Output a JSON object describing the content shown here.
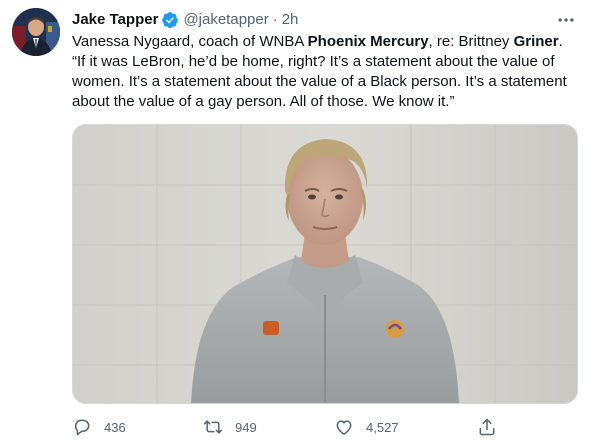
{
  "tweet": {
    "author_name": "Jake Tapper",
    "handle": "@jaketapper",
    "separator": "·",
    "time": "2h",
    "text_segments": [
      {
        "text": "Vanessa Nygaard, coach of WNBA ",
        "bold": false
      },
      {
        "text": "Phoenix Mercury",
        "bold": true
      },
      {
        "text": ", re: Brittney ",
        "bold": false
      },
      {
        "text": "Griner",
        "bold": true
      },
      {
        "text": ".",
        "bold": false
      }
    ],
    "quote": "“If it was LeBron, he’d be home, right? It’s a statement about the value of women. It’s a statement about the value of a Black person. It’s a statement about the value of a gay person. All of those. We know it.”"
  },
  "actions": {
    "reply_count": "436",
    "retweet_count": "949",
    "like_count": "4,527"
  },
  "icons": {
    "verified": "verified-badge-icon",
    "more": "more-options-icon",
    "reply": "reply-icon",
    "retweet": "retweet-icon",
    "like": "like-icon",
    "share": "share-icon"
  },
  "colors": {
    "text": "#0f1419",
    "secondary": "#536471",
    "verified": "#1d9bf0",
    "border": "#cfd9de"
  }
}
